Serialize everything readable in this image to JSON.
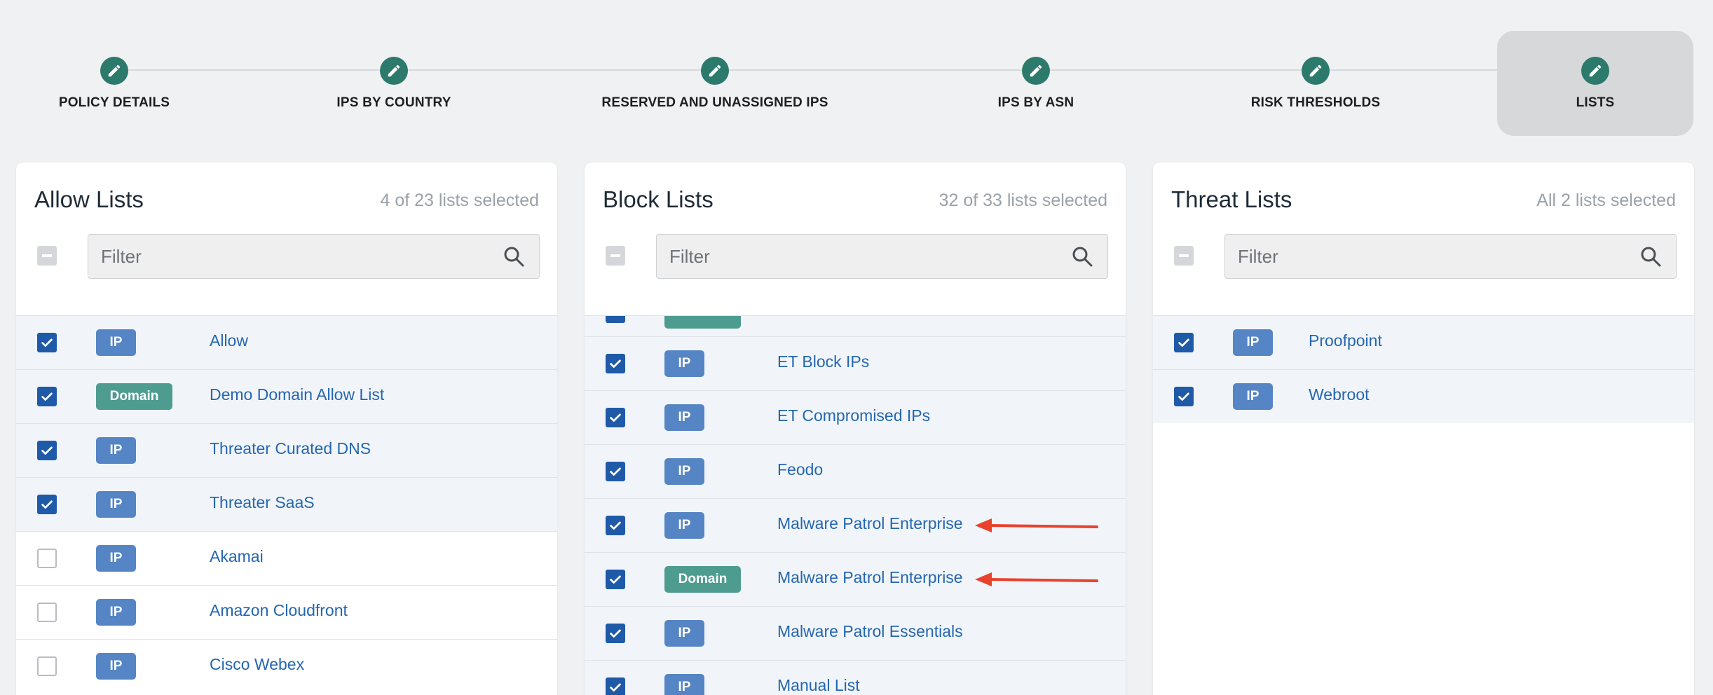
{
  "steps": [
    {
      "label": "POLICY DETAILS"
    },
    {
      "label": "IPS BY COUNTRY"
    },
    {
      "label": "RESERVED AND UNASSIGNED IPS"
    },
    {
      "label": "IPS BY ASN"
    },
    {
      "label": "RISK THRESHOLDS"
    },
    {
      "label": "LISTS",
      "active": true
    }
  ],
  "colors": {
    "step_circle": "#2c7a6b",
    "checkbox_checked": "#1f5aa8",
    "badge_ip": "#5585c4",
    "badge_domain": "#4e9c90",
    "link_text": "#2466b0",
    "annotation_arrow": "#e8412c"
  },
  "allow": {
    "title": "Allow Lists",
    "count": "4 of 23 lists selected",
    "filter_placeholder": "Filter",
    "rows": [
      {
        "badge": "IP",
        "name": "Allow",
        "checked": true
      },
      {
        "badge": "Domain",
        "name": "Demo Domain Allow List",
        "checked": true
      },
      {
        "badge": "IP",
        "name": "Threater Curated DNS",
        "checked": true
      },
      {
        "badge": "IP",
        "name": "Threater SaaS",
        "checked": true
      },
      {
        "badge": "IP",
        "name": "Akamai",
        "checked": false
      },
      {
        "badge": "IP",
        "name": "Amazon Cloudfront",
        "checked": false
      },
      {
        "badge": "IP",
        "name": "Cisco Webex",
        "checked": false
      }
    ]
  },
  "block": {
    "title": "Block Lists",
    "count": "32 of 33 lists selected",
    "filter_placeholder": "Filter",
    "rows": [
      {
        "badge": "IP",
        "name": "ET Block IPs",
        "checked": true
      },
      {
        "badge": "IP",
        "name": "ET Compromised IPs",
        "checked": true
      },
      {
        "badge": "IP",
        "name": "Feodo",
        "checked": true
      },
      {
        "badge": "IP",
        "name": "Malware Patrol Enterprise",
        "checked": true,
        "arrow": true
      },
      {
        "badge": "Domain",
        "name": "Malware Patrol Enterprise",
        "checked": true,
        "arrow": true
      },
      {
        "badge": "IP",
        "name": "Malware Patrol Essentials",
        "checked": true
      },
      {
        "badge": "IP",
        "name": "Manual List",
        "checked": true
      }
    ]
  },
  "threat": {
    "title": "Threat Lists",
    "count": "All 2 lists selected",
    "filter_placeholder": "Filter",
    "rows": [
      {
        "badge": "IP",
        "name": "Proofpoint",
        "checked": true
      },
      {
        "badge": "IP",
        "name": "Webroot",
        "checked": true
      }
    ]
  }
}
